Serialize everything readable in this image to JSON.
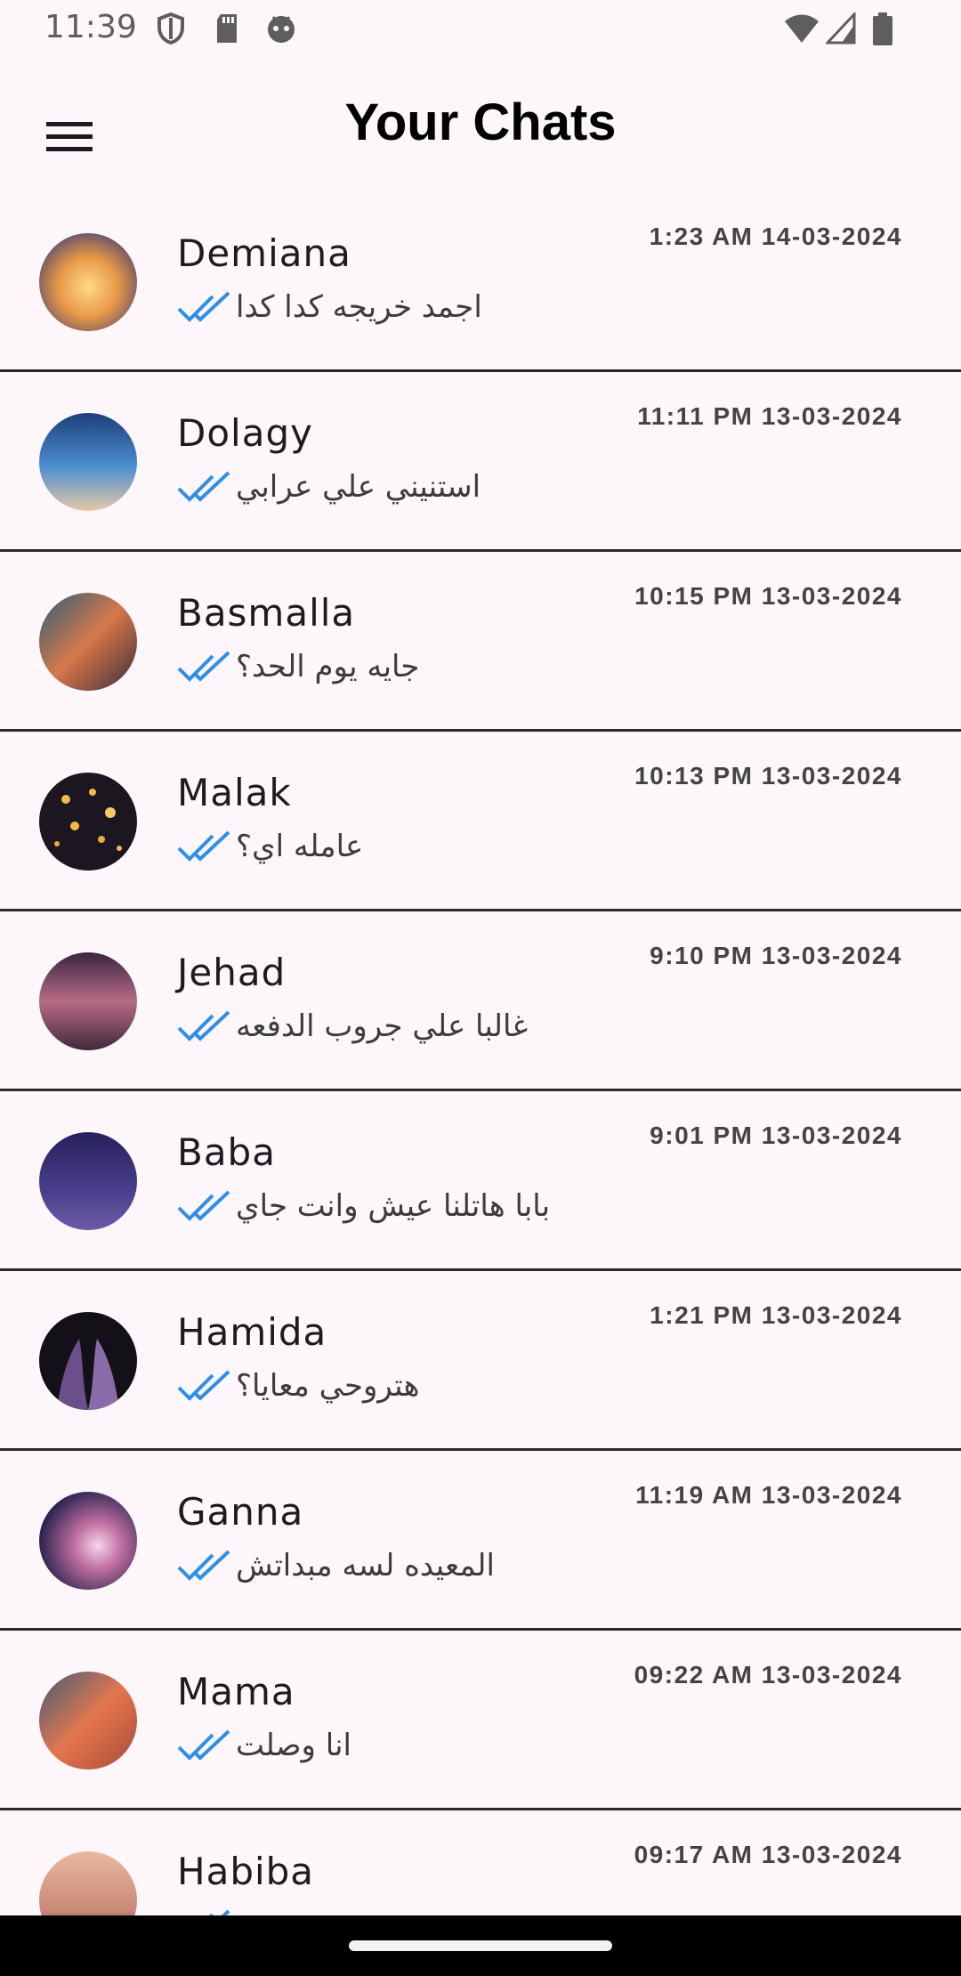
{
  "status_bar": {
    "time": "11:39",
    "icons": [
      "shield-icon",
      "sd-card-icon",
      "android-icon",
      "wifi-icon",
      "signal-icon",
      "battery-icon"
    ]
  },
  "app_bar": {
    "title": "Your Chats",
    "menu_icon": "menu-icon"
  },
  "colors": {
    "read_tick": "#2f8ee8",
    "divider": "#2b2b2b",
    "background": "#fdf7fb"
  },
  "chats": [
    {
      "name": "Demiana",
      "time": "1:23 AM 14-03-2024",
      "message": "اجمد خريجه كدا كدا"
    },
    {
      "name": "Dolagy",
      "time": "11:11 PM 13-03-2024",
      "message": "استنيني علي عرابي"
    },
    {
      "name": "Basmalla",
      "time": "10:15 PM 13-03-2024",
      "message": "جايه يوم الحد؟"
    },
    {
      "name": "Malak",
      "time": "10:13 PM 13-03-2024",
      "message": "عامله اي؟"
    },
    {
      "name": "Jehad",
      "time": "9:10 PM 13-03-2024",
      "message": "غالبا علي جروب الدفعه"
    },
    {
      "name": "Baba",
      "time": "9:01 PM 13-03-2024",
      "message": "بابا هاتلنا عيش وانت جاي"
    },
    {
      "name": "Hamida",
      "time": "1:21 PM 13-03-2024",
      "message": "هتروحي معايا؟"
    },
    {
      "name": "Ganna",
      "time": "11:19 AM 13-03-2024",
      "message": "المعيده لسه مبداتش"
    },
    {
      "name": "Mama",
      "time": "09:22 AM 13-03-2024",
      "message": "انا وصلت"
    },
    {
      "name": "Habiba",
      "time": "09:17 AM 13-03-2024",
      "message": ""
    }
  ]
}
